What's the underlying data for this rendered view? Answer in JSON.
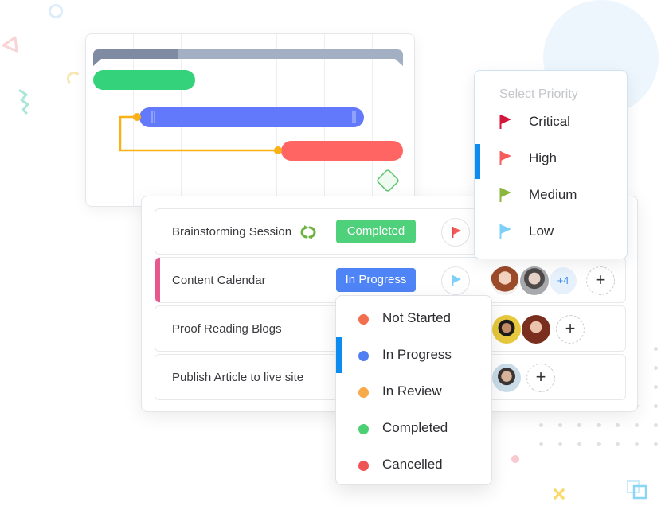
{
  "gantt": {
    "bars": [
      {
        "name": "summary-bar",
        "color": "#a3afc2",
        "progress_color": "#7f8ba2"
      },
      {
        "name": "green-task-bar",
        "color": "#34d27b"
      },
      {
        "name": "blue-task-bar",
        "color": "#6379fb"
      },
      {
        "name": "red-task-bar",
        "color": "#ff6663"
      }
    ],
    "dependency_color": "#f9b116",
    "milestone_color": "#5cc46a"
  },
  "tasks": [
    {
      "name": "Brainstorming Session",
      "status": "Completed",
      "status_color": "#4fd07a",
      "priority": "High",
      "priority_color": "#f35b5b",
      "recurring": true,
      "avatars": [],
      "extra_count": ""
    },
    {
      "name": "Content Calendar",
      "status": "In Progress",
      "status_color": "#4f84f6",
      "priority": "Low",
      "priority_color": "#7fd0f8",
      "recurring": false,
      "avatars": [
        "avatar-woman-red-hair",
        "avatar-man-gray"
      ],
      "extra_count": "+4",
      "highlighted": true
    },
    {
      "name": "Proof Reading Blogs",
      "avatars": [
        "avatar-man-cap",
        "avatar-woman-brown-hair"
      ]
    },
    {
      "name": "Publish Article to live site",
      "avatars": [
        "avatar-man-beard"
      ]
    }
  ],
  "priority_menu": {
    "title": "Select Priority",
    "items": [
      {
        "label": "Critical",
        "color": "#d3163c"
      },
      {
        "label": "High",
        "color": "#f55d5d",
        "selected": true
      },
      {
        "label": "Medium",
        "color": "#8db63f"
      },
      {
        "label": "Low",
        "color": "#7fd0f8"
      }
    ]
  },
  "status_menu": {
    "items": [
      {
        "label": "Not Started",
        "color": "#f26e4f"
      },
      {
        "label": "In Progress",
        "color": "#4f7ff3",
        "selected": true
      },
      {
        "label": "In Review",
        "color": "#f8a94a"
      },
      {
        "label": "Completed",
        "color": "#4dcf74"
      },
      {
        "label": "Cancelled",
        "color": "#f05555"
      }
    ]
  },
  "add_label": "+"
}
